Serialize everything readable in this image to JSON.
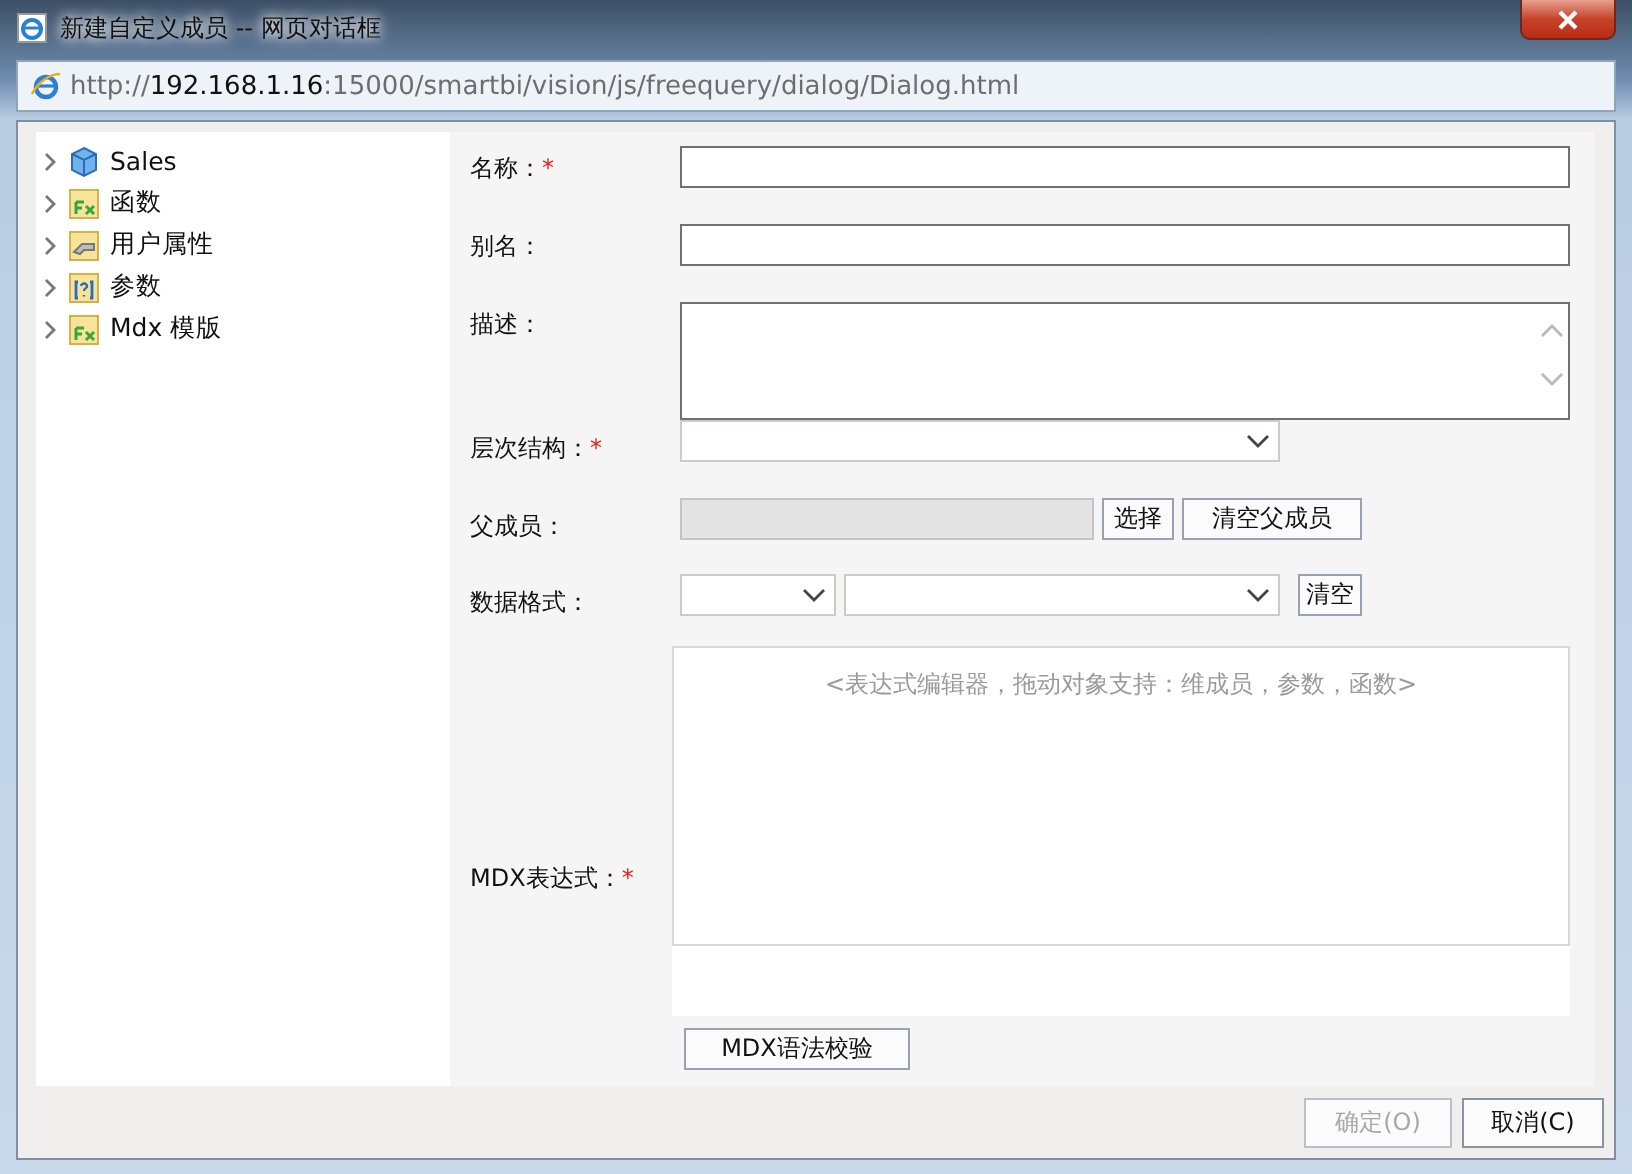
{
  "window": {
    "title": "新建自定义成员 -- 网页对话框"
  },
  "address_bar": {
    "scheme": "http://",
    "host": "192.168.1.16",
    "path": ":15000/smartbi/vision/js/freequery/dialog/Dialog.html"
  },
  "tree": {
    "items": [
      {
        "label": "Sales",
        "kind": "cube",
        "expanded": false
      },
      {
        "label": "函数",
        "kind": "function",
        "expanded": false
      },
      {
        "label": "用户属性",
        "kind": "user_attribute",
        "expanded": false
      },
      {
        "label": "参数",
        "kind": "parameter",
        "expanded": false
      },
      {
        "label": "Mdx 模版",
        "kind": "function",
        "expanded": false
      }
    ]
  },
  "form": {
    "fields": [
      {
        "label": "名称：",
        "required_mark": "*",
        "kind": "text"
      },
      {
        "label": "别名：",
        "kind": "text"
      },
      {
        "label": "描述：",
        "kind": "textarea"
      },
      {
        "label": "层次结构：",
        "required_mark": "*",
        "kind": "select"
      },
      {
        "label": "父成员：",
        "kind": "readonly",
        "buttons": [
          "选择",
          "清空父成员"
        ]
      },
      {
        "label": "数据格式：",
        "kind": "double_select",
        "buttons": [
          "清空"
        ]
      },
      {
        "label": "MDX表达式：",
        "required_mark": "*",
        "kind": "expression",
        "placeholder": "<表达式编辑器，拖动对象支持：维成员，参数，函数>",
        "buttons": [
          "MDX语法校验"
        ]
      }
    ]
  },
  "footer": {
    "buttons": [
      {
        "label": "确定(O)",
        "disabled": true
      },
      {
        "label": "取消(C)",
        "disabled": false
      }
    ]
  }
}
